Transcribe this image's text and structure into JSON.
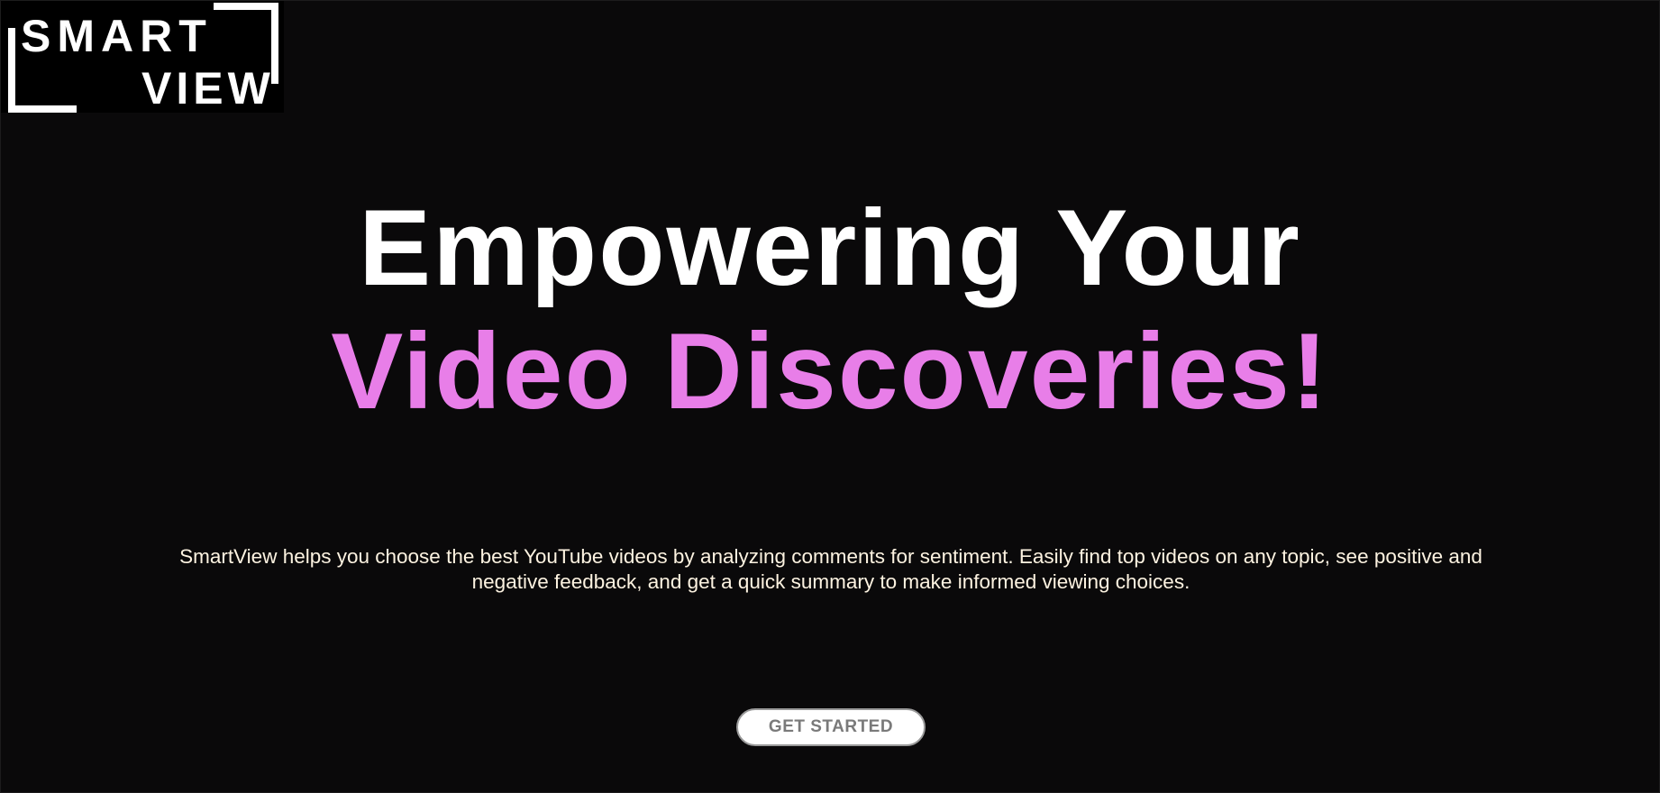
{
  "logo": {
    "line1": "SMART",
    "line2": "VIEW"
  },
  "hero": {
    "headline_line1": "Empowering Your",
    "headline_line2": "Video Discoveries!",
    "description": "SmartView helps you choose the best YouTube videos by analyzing comments for sentiment. Easily find top videos on any topic, see positive and negative feedback, and get a quick summary to make informed viewing choices.",
    "cta_label": "GET STARTED"
  },
  "colors": {
    "background": "#0a090a",
    "headline_primary": "#ffffff",
    "headline_accent": "#e87ee8",
    "description_text": "#fdf3e1",
    "button_bg": "#ffffff",
    "button_text": "#7a7a7a"
  }
}
